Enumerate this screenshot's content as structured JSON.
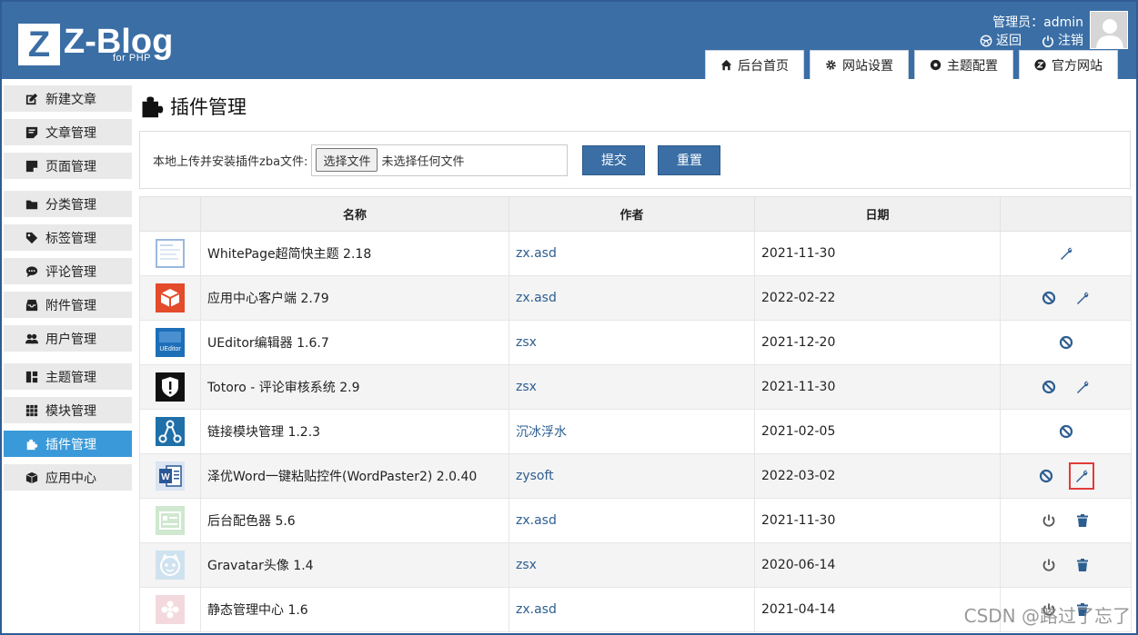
{
  "header": {
    "logo_letter": "Z",
    "logo_text": "Z-Blog",
    "logo_sub": "for PHP",
    "user_label": "管理员：admin",
    "back_label": "返回",
    "logout_label": "注销"
  },
  "topnav": [
    {
      "label": "后台首页",
      "icon": "home-icon"
    },
    {
      "label": "网站设置",
      "icon": "gear-icon"
    },
    {
      "label": "主题配置",
      "icon": "theme-icon"
    },
    {
      "label": "官方网站",
      "icon": "zblog-icon"
    }
  ],
  "sidebar": [
    {
      "label": "新建文章"
    },
    {
      "label": "文章管理"
    },
    {
      "label": "页面管理"
    },
    {
      "label": "分类管理"
    },
    {
      "label": "标签管理"
    },
    {
      "label": "评论管理"
    },
    {
      "label": "附件管理"
    },
    {
      "label": "用户管理"
    },
    {
      "label": "主题管理"
    },
    {
      "label": "模块管理"
    },
    {
      "label": "插件管理"
    },
    {
      "label": "应用中心"
    }
  ],
  "page_title": "插件管理",
  "upload": {
    "label": "本地上传并安装插件zba文件:",
    "choose_file": "选择文件",
    "no_file": "未选择任何文件",
    "submit": "提交",
    "reset": "重置"
  },
  "table": {
    "headers": [
      "名称",
      "作者",
      "日期"
    ],
    "rows": [
      {
        "name": "WhitePage超简快主题 2.18",
        "author": "zx.asd",
        "date": "2021-11-30",
        "icon": "whitepage-icon",
        "actions": [
          "config"
        ]
      },
      {
        "name": "应用中心客户端 2.79",
        "author": "zx.asd",
        "date": "2022-02-22",
        "icon": "appcenter-icon",
        "actions": [
          "disable",
          "config"
        ]
      },
      {
        "name": "UEditor编辑器 1.6.7",
        "author": "zsx",
        "date": "2021-12-20",
        "icon": "ueditor-icon",
        "actions": [
          "disable"
        ]
      },
      {
        "name": "Totoro - 评论审核系统 2.9",
        "author": "zsx",
        "date": "2021-11-30",
        "icon": "totoro-icon",
        "actions": [
          "disable",
          "config"
        ]
      },
      {
        "name": "链接模块管理 1.2.3",
        "author": "沉冰浮水",
        "date": "2021-02-05",
        "icon": "link-module-icon",
        "actions": [
          "disable"
        ]
      },
      {
        "name": "泽优Word一键粘贴控件(WordPaster2) 2.0.40",
        "author": "zysoft",
        "date": "2022-03-02",
        "icon": "word-icon",
        "actions": [
          "disable",
          "config-highlighted"
        ]
      },
      {
        "name": "后台配色器 5.6",
        "author": "zx.asd",
        "date": "2021-11-30",
        "icon": "color-icon",
        "actions": [
          "enable",
          "delete"
        ]
      },
      {
        "name": "Gravatar头像 1.4",
        "author": "zsx",
        "date": "2020-06-14",
        "icon": "gravatar-icon",
        "actions": [
          "enable",
          "delete"
        ]
      },
      {
        "name": "静态管理中心 1.6",
        "author": "zx.asd",
        "date": "2021-04-14",
        "icon": "static-icon",
        "actions": [
          "enable",
          "delete"
        ]
      }
    ]
  },
  "watermark": "CSDN @路过了忘了",
  "colors": {
    "header": "#3a6ea5",
    "active": "#3a9ad9",
    "link": "#2d5e91",
    "highlight": "#e03b3b"
  }
}
